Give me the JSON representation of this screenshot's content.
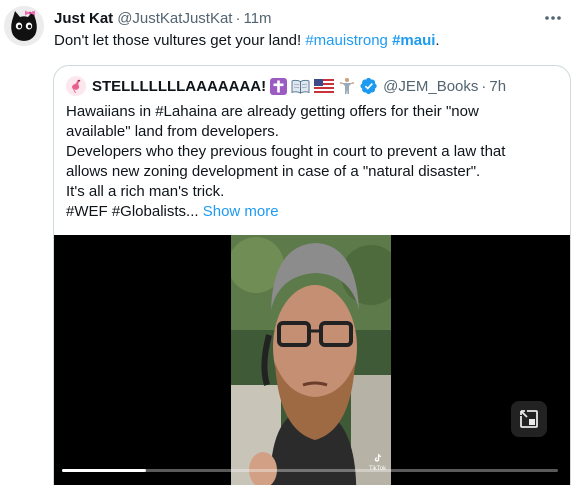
{
  "tweet": {
    "display_name": "Just Kat",
    "handle": "@JustKatJustKat",
    "separator": "·",
    "time": "11m",
    "text_before": "Don't let those vultures get your land! ",
    "hashtag1": "#mauistrong",
    "hashtag2": "#maui",
    "text_after": "."
  },
  "quote": {
    "display_name": "STELLLLLLLAAAAAAA!",
    "emojis": [
      "cross-emoji",
      "book-emoji",
      "us-flag-emoji",
      "person-emoji"
    ],
    "handle": "@JEM_Books",
    "separator": "·",
    "time": "7h",
    "lines": [
      "Hawaiians in #Lahaina are already getting offers for their \"now",
      "available\" land from developers.",
      "Developers who they previous fought in court to prevent a law that",
      "allows new zoning development in case of a \"natural disaster\".",
      "It's all a rich man's trick."
    ],
    "last_line": "#WEF #Globalists...",
    "show_more": "Show more"
  },
  "video": {
    "progress": 0.17,
    "watermark": "TikTok"
  },
  "colors": {
    "link": "#1d9bf0",
    "secondary": "#536471",
    "border": "#cfd9de"
  }
}
